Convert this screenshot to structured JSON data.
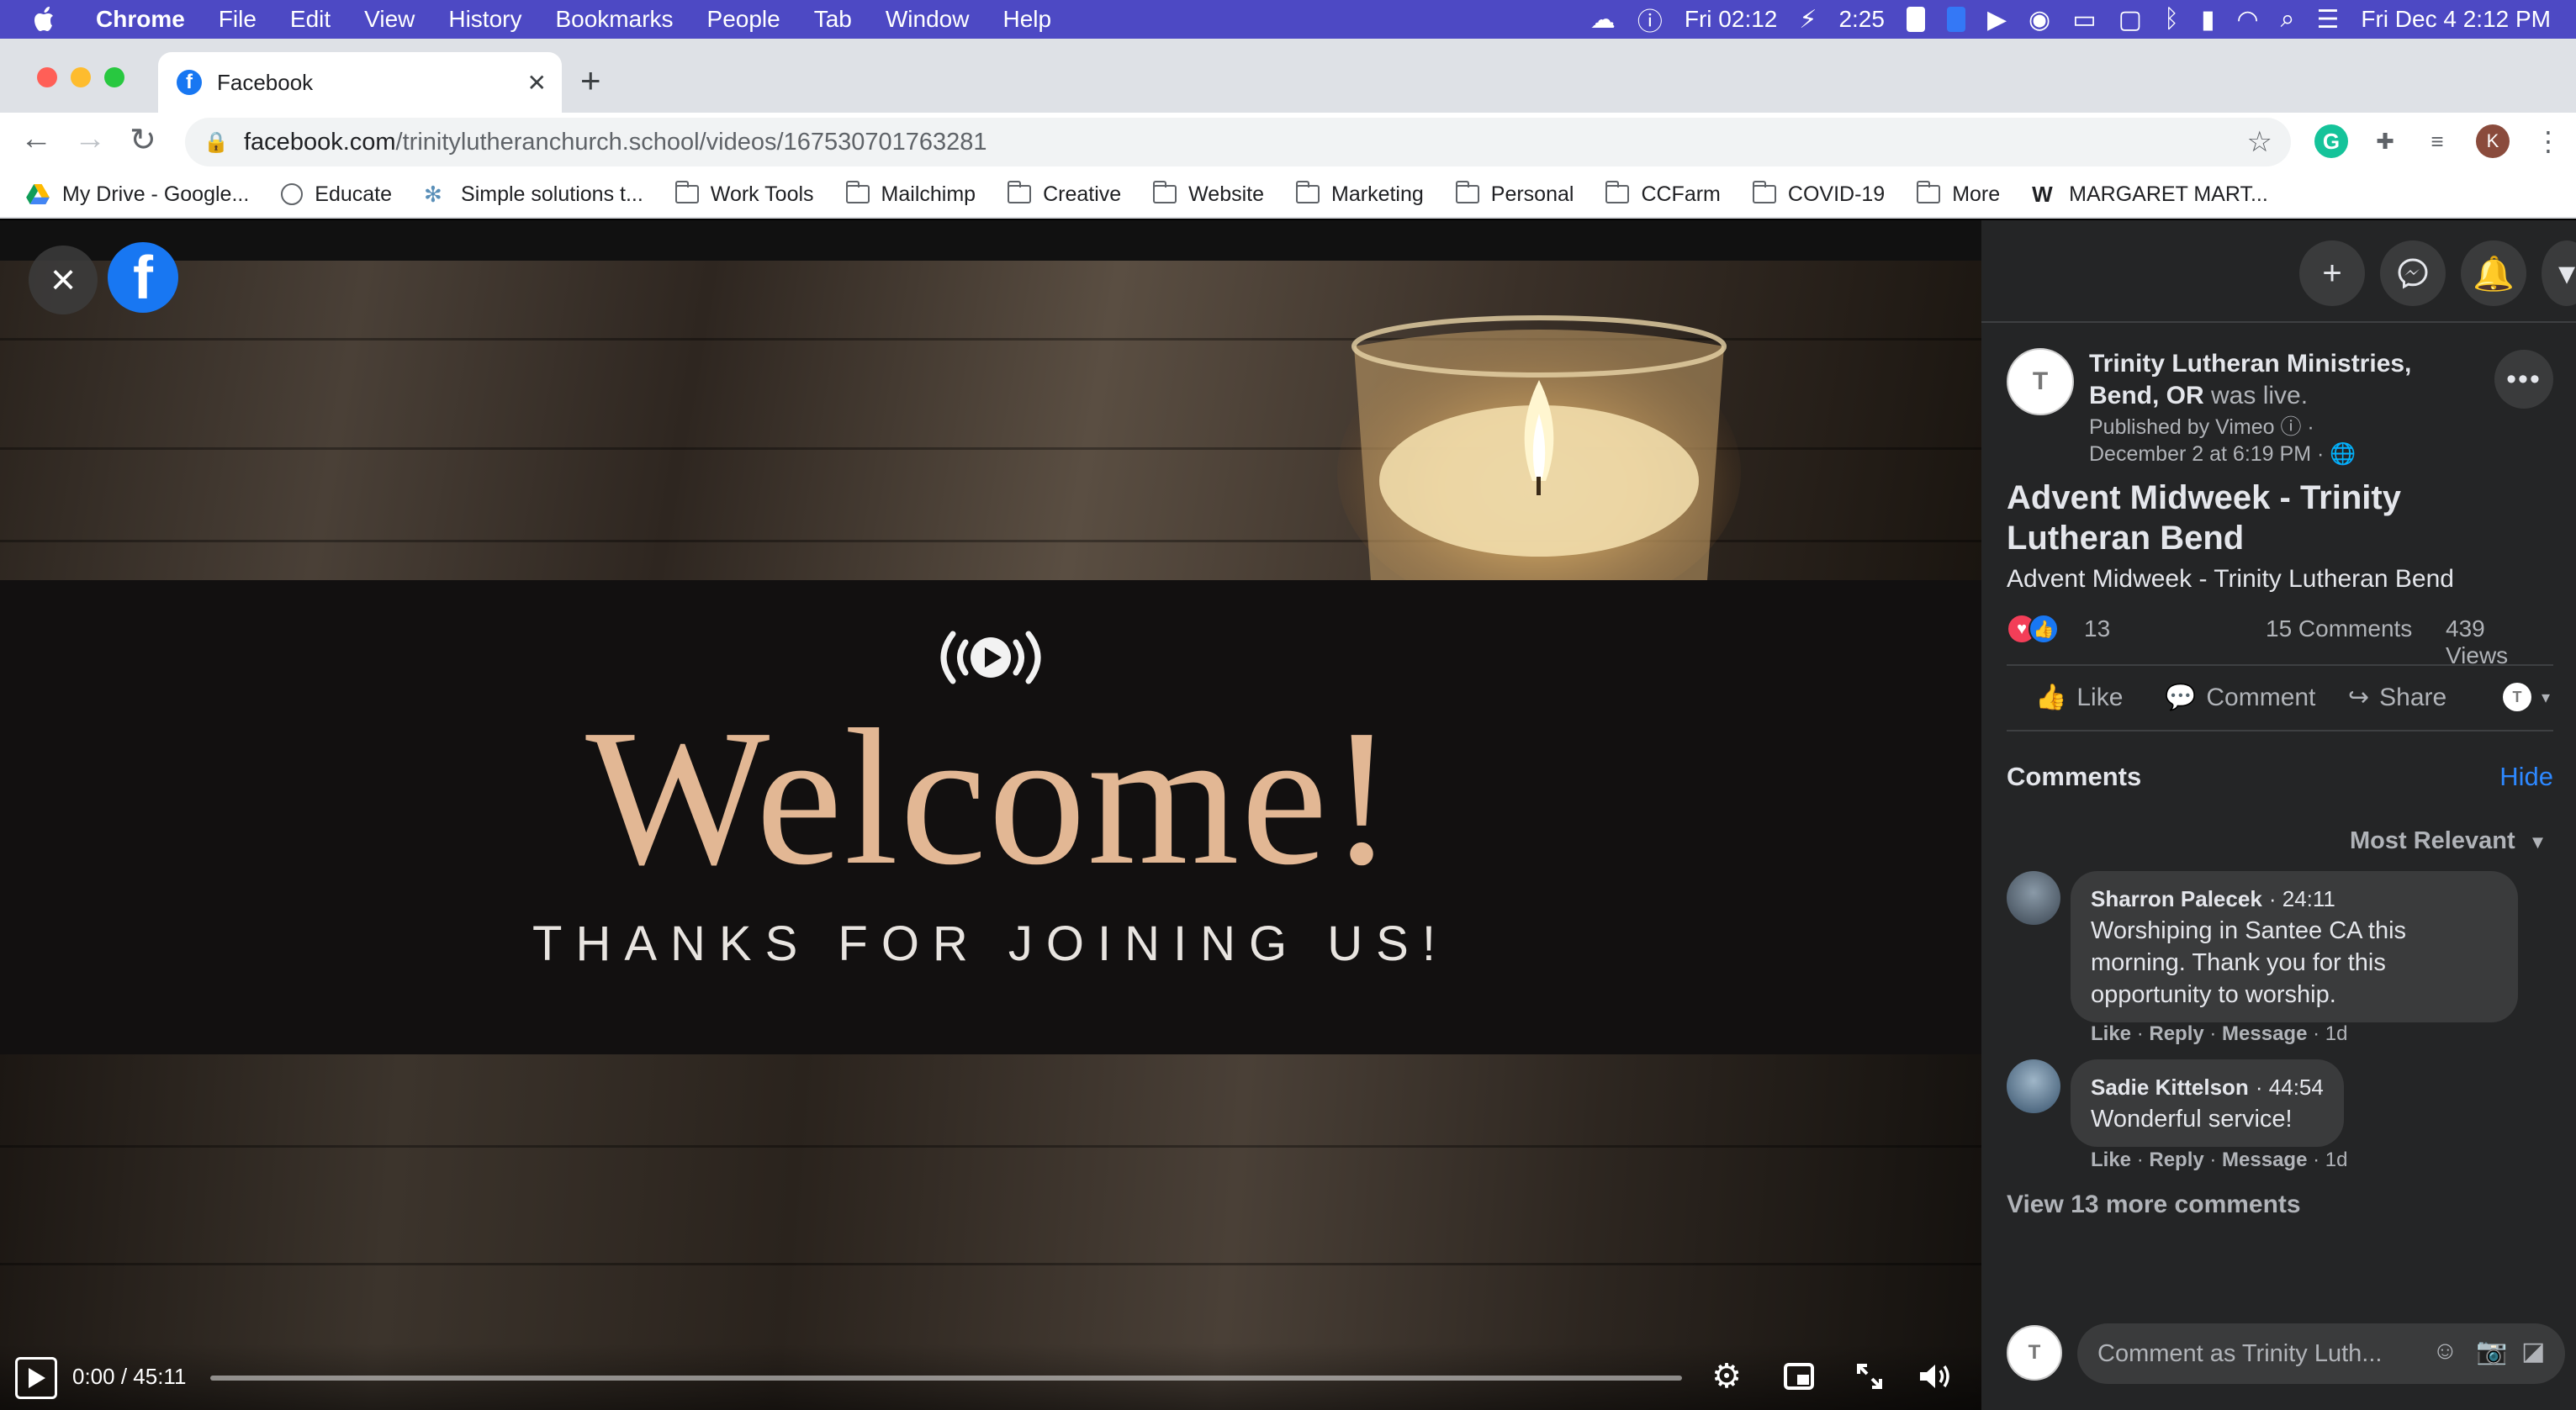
{
  "menubar": {
    "app": "Chrome",
    "items": [
      "File",
      "Edit",
      "View",
      "History",
      "Bookmarks",
      "People",
      "Tab",
      "Window",
      "Help"
    ],
    "clock1": "Fri 02:12",
    "battery_time": "2:25",
    "datetime": "Fri Dec 4  2:12 PM"
  },
  "tab": {
    "title": "Facebook"
  },
  "address": {
    "domain": "facebook.com",
    "path": "/trinitylutheranchurch.school/videos/167530701763281"
  },
  "profile_initial": "K",
  "bookmarks": [
    {
      "label": "My Drive - Google...",
      "icon": "drive-icon"
    },
    {
      "label": "Educate",
      "icon": "educate-icon"
    },
    {
      "label": "Simple solutions t...",
      "icon": "gear-icon"
    },
    {
      "label": "Work Tools",
      "icon": "folder-icon"
    },
    {
      "label": "Mailchimp",
      "icon": "folder-icon"
    },
    {
      "label": "Creative",
      "icon": "folder-icon"
    },
    {
      "label": "Website",
      "icon": "folder-icon"
    },
    {
      "label": "Marketing",
      "icon": "folder-icon"
    },
    {
      "label": "Personal",
      "icon": "folder-icon"
    },
    {
      "label": "CCFarm",
      "icon": "folder-icon"
    },
    {
      "label": "COVID-19",
      "icon": "folder-icon"
    },
    {
      "label": "More",
      "icon": "folder-icon"
    },
    {
      "label": "MARGARET MART...",
      "icon": "w-icon"
    }
  ],
  "video": {
    "headline": "Welcome!",
    "subline": "THANKS FOR JOINING US!",
    "time": "0:00 / 45:11",
    "progress": 0
  },
  "post": {
    "page_name": "Trinity Lutheran Ministries, Bend, OR",
    "live_text": "was live.",
    "publisher": "Published by Vimeo",
    "date": "December 2 at 6:19 PM",
    "title": "Advent Midweek - Trinity Lutheran Bend",
    "description": "Advent Midweek - Trinity Lutheran Bend",
    "reaction_count": "13",
    "comments_count": "15 Comments",
    "views": "439 Views",
    "actions": {
      "like": "Like",
      "comment": "Comment",
      "share": "Share"
    }
  },
  "comments_section": {
    "heading": "Comments",
    "hide": "Hide",
    "sort": "Most Relevant",
    "items": [
      {
        "author": "Sharron Palecek",
        "timestamp": "24:11",
        "lines": [
          "Worshiping in Santee CA this",
          "morning. Thank you for this",
          "opportunity to worship."
        ],
        "like": "Like",
        "reply": "Reply",
        "message": "Message",
        "age": "1d"
      },
      {
        "author": "Sadie Kittelson",
        "timestamp": "44:54",
        "lines": [
          "Wonderful service!"
        ],
        "like": "Like",
        "reply": "Reply",
        "message": "Message",
        "age": "1d"
      }
    ],
    "view_more": "View 13 more comments",
    "composer_placeholder": "Comment as Trinity Luth..."
  },
  "colors": {
    "menubar": "#4d49c4",
    "panel": "#242526",
    "facebook_blue": "#1877f2",
    "welcome_gold": "#e2b794"
  }
}
